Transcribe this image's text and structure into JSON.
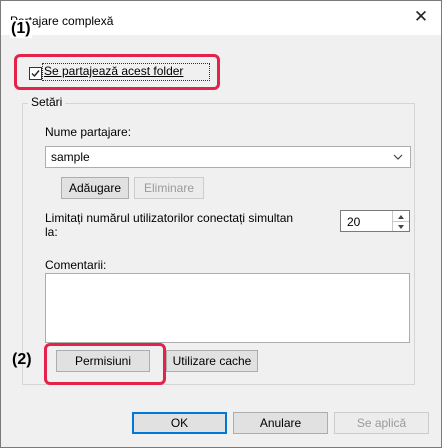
{
  "window": {
    "title": "Partajare complexă",
    "close_glyph": "✕"
  },
  "callouts": {
    "one": "(1)",
    "two": "(2)",
    "color": "#e5224c"
  },
  "share": {
    "checkbox_label": "Se partajează acest folder",
    "checked": true
  },
  "settings": {
    "group_label": "Setări",
    "share_name_label": "Nume partajare:",
    "share_name_value": "sample",
    "add_button": "Adăugare",
    "remove_button": "Eliminare",
    "limit_label_line1": "Limitați numărul utilizatorilor conectați simultan",
    "limit_label_line2": "la:",
    "limit_value": "20",
    "comments_label": "Comentarii:",
    "comments_value": "",
    "permissions_button": "Permisiuni",
    "caching_button": "Utilizare cache"
  },
  "footer": {
    "ok_button": "OK",
    "cancel_button": "Anulare",
    "apply_button": "Se aplică"
  },
  "icons": {
    "checkmark": "check-icon",
    "dropdown": "chevron-down-icon",
    "spin_up": "spin-up-icon",
    "spin_down": "spin-down-icon",
    "close": "close-icon"
  },
  "colors": {
    "accent": "#0078d7",
    "highlight": "#e5224c"
  }
}
